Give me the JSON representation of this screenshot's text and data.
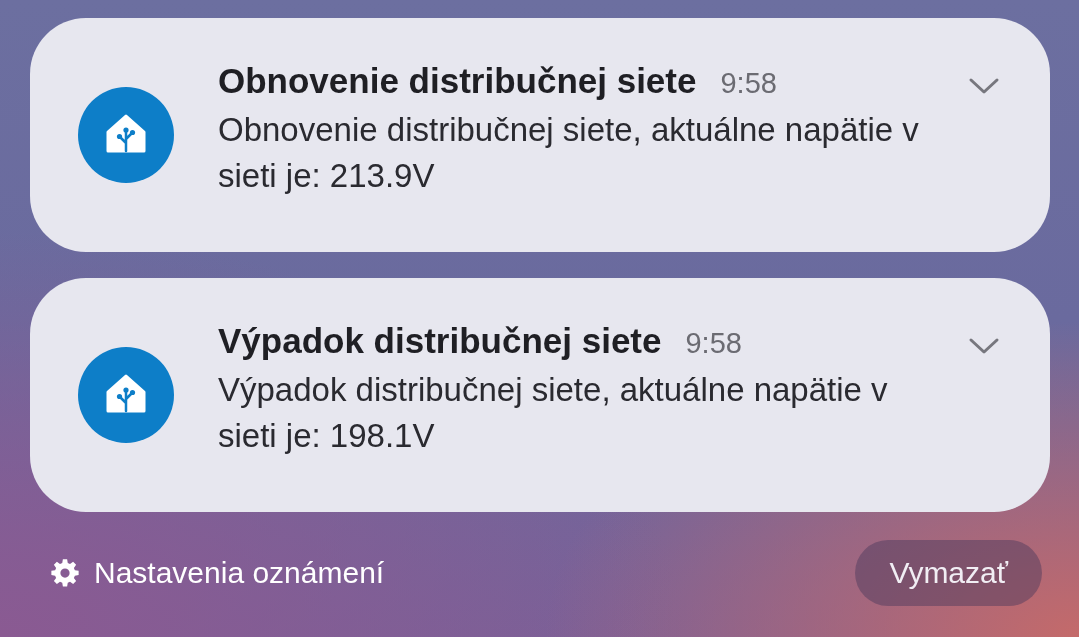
{
  "notifications": [
    {
      "title": "Obnovenie distribučnej siete",
      "time": "9:58",
      "body": "Obnovenie distribučnej siete, aktuálne napätie v sieti je: 213.9V"
    },
    {
      "title": "Výpadok distribučnej siete",
      "time": "9:58",
      "body": "Výpadok distribučnej siete, aktuálne napätie v sieti je: 198.1V"
    }
  ],
  "footer": {
    "settings_label": "Nastavenia oznámení",
    "clear_button": "Vymazať"
  }
}
